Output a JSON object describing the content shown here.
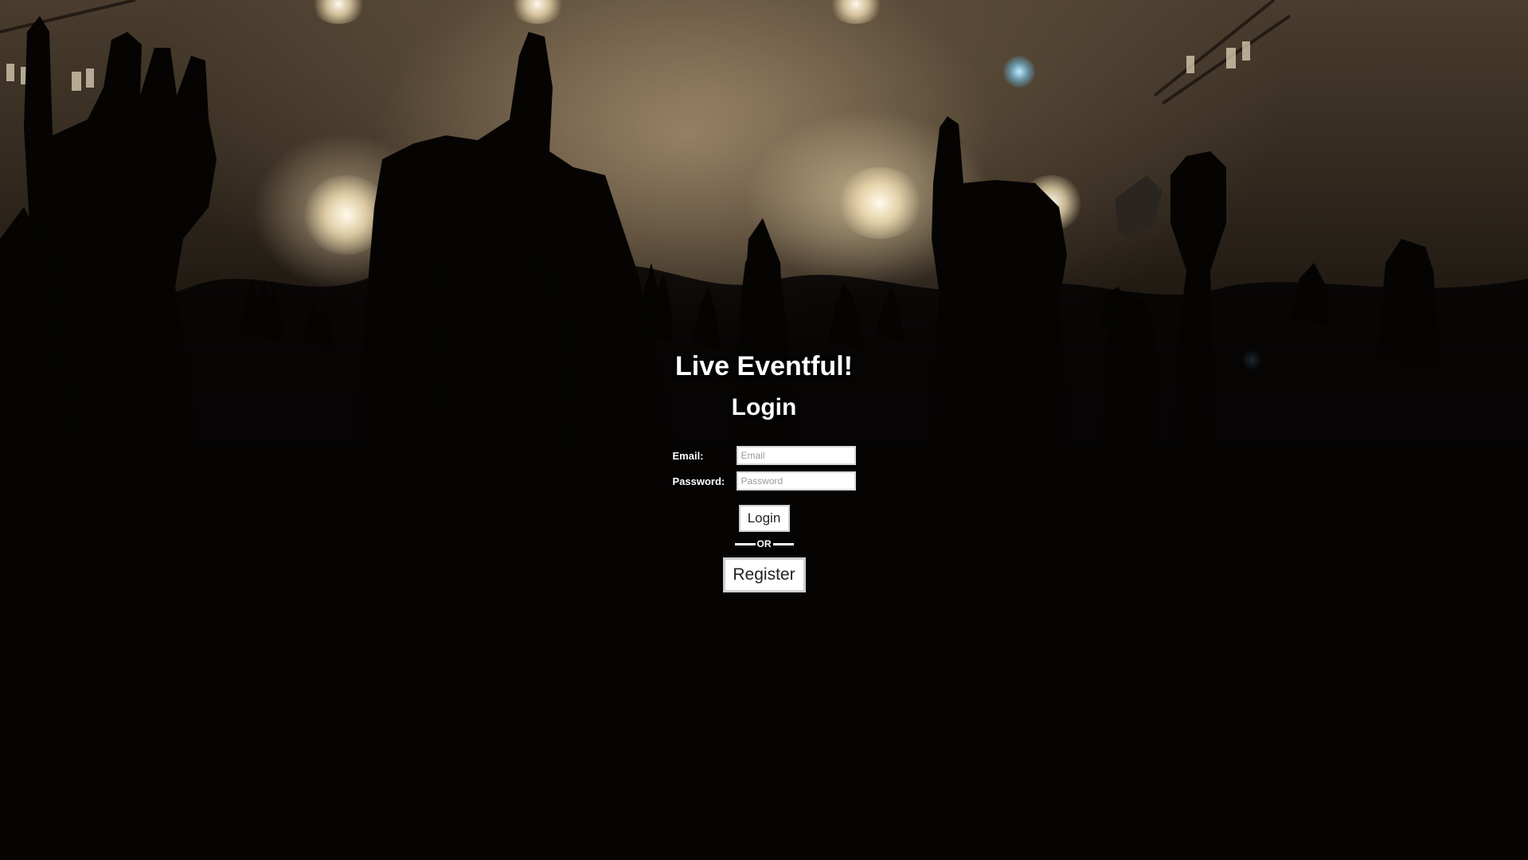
{
  "app": {
    "title": "Live Eventful!"
  },
  "login": {
    "heading": "Login",
    "email": {
      "label": "Email:",
      "placeholder": "Email",
      "value": ""
    },
    "password": {
      "label": "Password:",
      "placeholder": "Password",
      "value": ""
    },
    "login_button": "Login",
    "divider_text": "OR",
    "register_button": "Register"
  },
  "background": {
    "icon": "concert-crowd-image",
    "colors": {
      "light": "#fff4dc",
      "haze": "#6e5c46",
      "dark": "#050403",
      "blue_light": "#8fd2f0"
    }
  }
}
